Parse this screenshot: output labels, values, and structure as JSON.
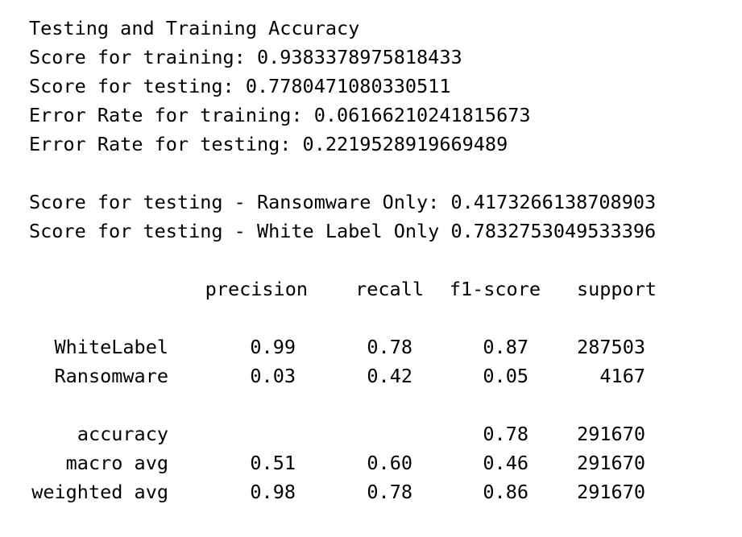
{
  "output": {
    "heading": "Testing and Training Accuracy",
    "score_training": "Score for training: 0.9383378975818433",
    "score_testing": "Score for testing: 0.7780471080330511",
    "error_training": "Error Rate for training: 0.06166210241815673",
    "error_testing": "Error Rate for testing: 0.2219528919669489",
    "score_ransomware": "Score for testing - Ransomware Only: 0.4173266138708903",
    "score_whitelabel": "Score for testing - White Label Only 0.7832753049533396"
  },
  "report": {
    "columns": [
      "precision",
      "recall",
      "f1-score",
      "support"
    ],
    "rows": [
      {
        "label": "WhiteLabel",
        "precision": "0.99",
        "recall": "0.78",
        "f1": "0.87",
        "support": "287503"
      },
      {
        "label": "Ransomware",
        "precision": "0.03",
        "recall": "0.42",
        "f1": "0.05",
        "support": "4167"
      },
      {
        "label": "accuracy",
        "precision": "",
        "recall": "",
        "f1": "0.78",
        "support": "291670"
      },
      {
        "label": "macro avg",
        "precision": "0.51",
        "recall": "0.60",
        "f1": "0.46",
        "support": "291670"
      },
      {
        "label": "weighted avg",
        "precision": "0.98",
        "recall": "0.78",
        "f1": "0.86",
        "support": "291670"
      }
    ]
  }
}
